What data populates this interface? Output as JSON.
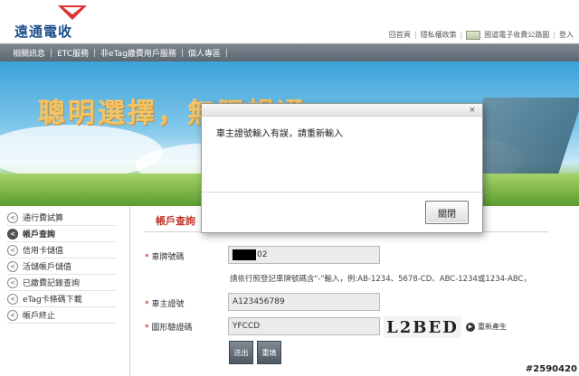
{
  "header": {
    "logo_text": "遠通電收",
    "top_links": [
      "回首頁",
      "隱私權政策",
      "國道電子收費公路圖",
      "登入"
    ]
  },
  "nav": {
    "items": [
      "相關訊息",
      "ETC服務",
      "非eTag繳費用戶服務",
      "個人專區"
    ]
  },
  "banner": {
    "slogan": "聰明選擇，無限暢通"
  },
  "sidebar": {
    "items": [
      {
        "label": "通行費試算",
        "active": false
      },
      {
        "label": "帳戶查詢",
        "active": true
      },
      {
        "label": "信用卡儲值",
        "active": false
      },
      {
        "label": "活儲帳戶儲值",
        "active": false
      },
      {
        "label": "已繳費記錄查詢",
        "active": false
      },
      {
        "label": "eTag卡條碼下載",
        "active": false
      },
      {
        "label": "帳戶終止",
        "active": false
      }
    ]
  },
  "main": {
    "title": "帳戶查詢",
    "plate_label": "車牌號碼",
    "plate_value_suffix": "02",
    "hint": "請依行照登記車牌號碼含\"-\"輸入，例:AB-1234、5678-CD、ABC-1234或1234-ABC，",
    "owner_id_label": "車主證號",
    "owner_id_value": "A123456789",
    "captcha_label": "圖形驗證碼",
    "captcha_value": "YFCCD",
    "captcha_image_text": "L2BED",
    "refresh_label": "重新產生",
    "submit_label": "送出",
    "reset_label": "重填"
  },
  "modal": {
    "message": "車主證號輸入有誤，請重新輸入",
    "close_label": "關閉",
    "close_x": "×"
  },
  "watermark": "#2590420"
}
